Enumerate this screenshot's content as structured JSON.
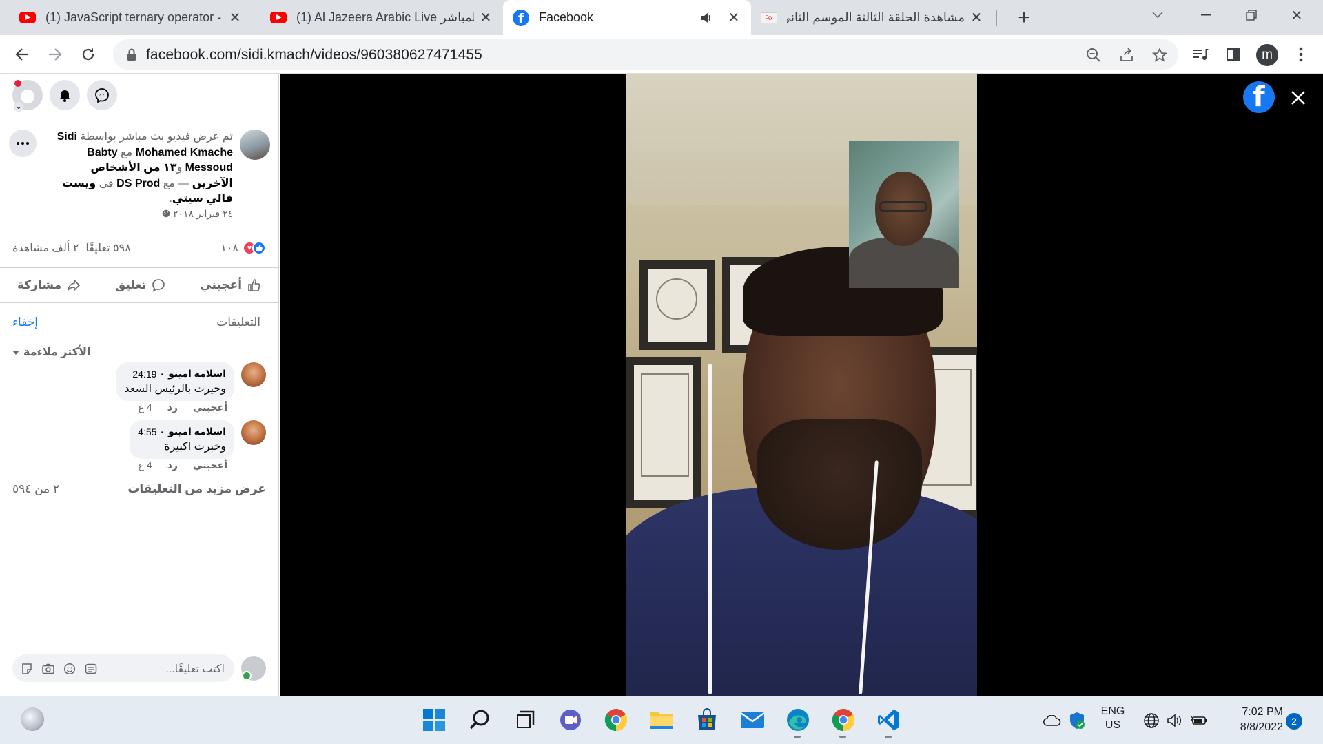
{
  "browser": {
    "tabs": [
      {
        "title": "(1) JavaScript ternary operator - Y",
        "icon": "youtube-icon"
      },
      {
        "title": "(1) Al Jazeera Arabic Live المباشر",
        "icon": "youtube-icon"
      },
      {
        "title": "Facebook",
        "icon": "facebook-icon",
        "active": true,
        "audio": true
      },
      {
        "title": "مشاهدة الحلقة الثالثة الموسم الثاني",
        "icon": "egybest-icon"
      }
    ],
    "url": "facebook.com/sidi.kmach/videos/960380627471455",
    "profile_initial": "m"
  },
  "sidebar": {
    "post": {
      "prefix": "تم عرض فيديو بث مباشر بواسطة",
      "author": "Sidi Mohamed Kmache",
      "with_word": "مع",
      "tagged": "Babty Messoud",
      "and_word": "و",
      "others": "١٣ من الأشخاص الآخرين",
      "dash_with": "— مع",
      "page": "DS Prod",
      "in_word": "في",
      "location": "ويست فالي سيتي",
      "date": "٢٤ فبراير ٢٠١٨"
    },
    "stats": {
      "reactions_count": "١٠٨",
      "comments": "٥٩٨ تعليقًا",
      "views": "٢ ألف مشاهدة"
    },
    "actions": {
      "like": "أعجبني",
      "comment": "تعليق",
      "share": "مشاركة"
    },
    "comments_section": {
      "title": "التعليقات",
      "hide": "إخفاء",
      "sort": "الأكثر ملاءمة",
      "items": [
        {
          "name": "اسلامه امينو",
          "time": "24:19",
          "text": "وحيرت بالرئيس السعد",
          "like": "أعجبني",
          "reply": "رد",
          "age": "4 ع"
        },
        {
          "name": "اسلامه امينو",
          "time": "4:55",
          "text": "وخبرت اكبيرة",
          "like": "أعجبني",
          "reply": "رد",
          "age": "4 ع"
        }
      ],
      "more_label": "عرض مزيد من التعليقات",
      "more_count": "٢ من ٥٩٤"
    },
    "composer": {
      "placeholder": "اكتب تعليقًا..."
    }
  },
  "taskbar": {
    "apps": [
      "windows-start-icon",
      "search-icon",
      "task-view-icon",
      "teams-chat-icon",
      "chrome-icon",
      "file-explorer-icon",
      "microsoft-store-icon",
      "mail-icon",
      "edge-icon",
      "chrome-icon",
      "vscode-icon"
    ],
    "language": "ENG",
    "region": "US",
    "time": "7:02 PM",
    "date": "8/8/2022",
    "notifications": "2"
  },
  "colors": {
    "facebook_blue": "#1877f2",
    "chrome_tabstrip": "#dee1e6",
    "taskbar": "#e4ebf3"
  }
}
